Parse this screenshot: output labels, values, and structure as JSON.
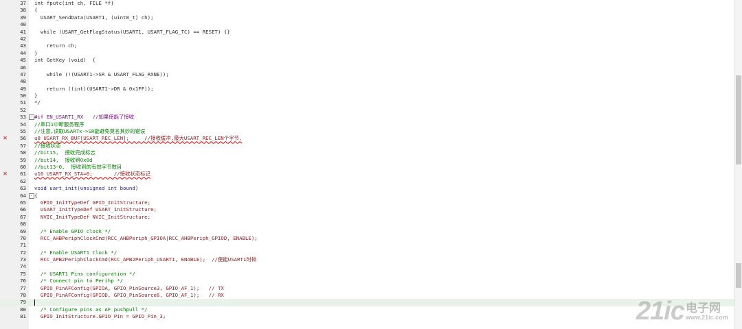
{
  "editor": {
    "lines": [
      {
        "n": "37",
        "text": "int fputc(int ch, FILE *f)",
        "cls": ""
      },
      {
        "n": "38",
        "text": "{",
        "cls": ""
      },
      {
        "n": "39",
        "text": "  USART_SendData(USART1, (uint8_t) ch);",
        "cls": ""
      },
      {
        "n": "40",
        "text": "",
        "cls": ""
      },
      {
        "n": "41",
        "text": "  while (USART_GetFlagStatus(USART1, USART_FLAG_TC) == RESET) {}",
        "cls": ""
      },
      {
        "n": "42",
        "text": "",
        "cls": ""
      },
      {
        "n": "43",
        "text": "    return ch;",
        "cls": ""
      },
      {
        "n": "44",
        "text": "}",
        "cls": ""
      },
      {
        "n": "45",
        "text": "int GetKey (void)  {",
        "cls": ""
      },
      {
        "n": "46",
        "text": "",
        "cls": ""
      },
      {
        "n": "47",
        "text": "    while (!(USART1->SR & USART_FLAG_RXNE));",
        "cls": ""
      },
      {
        "n": "48",
        "text": "",
        "cls": ""
      },
      {
        "n": "49",
        "text": "    return ((int)(USART1->DR & 0x1FF));",
        "cls": ""
      },
      {
        "n": "50",
        "text": "}",
        "cls": ""
      },
      {
        "n": "51",
        "text": "*/",
        "cls": ""
      },
      {
        "n": "52",
        "text": "",
        "cls": ""
      },
      {
        "n": "53",
        "text": "#if EN_USART1_RX   //如果使能了接收",
        "cls": "k-pre",
        "fold": "-"
      },
      {
        "n": "54",
        "text": "//串口1中断服务程序",
        "cls": "k-comment"
      },
      {
        "n": "55",
        "text": "//注意,读取USARTx->SR能避免莫名其妙的错误",
        "cls": "k-comment"
      },
      {
        "n": "56",
        "text": "u8 USART_RX_BUF[USART_REC_LEN];     //接收缓冲,最大USART_REC_LEN个字节.",
        "cls": "k-err",
        "err": "✕"
      },
      {
        "n": "57",
        "text": "//接收状态",
        "cls": "k-comment"
      },
      {
        "n": "58",
        "text": "//bit15,  接收完成标志",
        "cls": "k-comment"
      },
      {
        "n": "59",
        "text": "//bit14,  接收到0x0d",
        "cls": "k-comment"
      },
      {
        "n": "60",
        "text": "//bit13~0,  接收到的有效字节数目",
        "cls": "k-comment"
      },
      {
        "n": "61",
        "text": "u16 USART_RX_STA=0;       //接收状态标记",
        "cls": "k-err",
        "err": "✕"
      },
      {
        "n": "62",
        "text": "",
        "cls": ""
      },
      {
        "n": "63",
        "text": "void uart_init(unsigned int bound)",
        "cls": "k-decl"
      },
      {
        "n": "64",
        "text": "{",
        "cls": "",
        "fold": "-"
      },
      {
        "n": "65",
        "text": "  GPIO_InitTypeDef GPIO_InitStructure;",
        "cls": "k-func"
      },
      {
        "n": "66",
        "text": "  USART_InitTypeDef USART_InitStructure;",
        "cls": "k-func"
      },
      {
        "n": "67",
        "text": "  NVIC_InitTypeDef NVIC_InitStructure;",
        "cls": "k-func"
      },
      {
        "n": "68",
        "text": "",
        "cls": ""
      },
      {
        "n": "69",
        "text": "  /* Enable GPIO clock */",
        "cls": "k-comment"
      },
      {
        "n": "70",
        "text": "  RCC_AHBPeriphClockCmd(RCC_AHBPeriph_GPIOA|RCC_AHBPeriph_GPIOD, ENABLE);",
        "cls": "k-func"
      },
      {
        "n": "71",
        "text": "",
        "cls": ""
      },
      {
        "n": "72",
        "text": "  /* Enable USART1 Clock */",
        "cls": "k-comment"
      },
      {
        "n": "73",
        "text": "  RCC_APB2PeriphClockCmd(RCC_APB2Periph_USART1, ENABLE);  //使能USART1时钟",
        "cls": "k-func"
      },
      {
        "n": "74",
        "text": "",
        "cls": ""
      },
      {
        "n": "75",
        "text": "  /* USART1 Pins configuration */",
        "cls": "k-comment"
      },
      {
        "n": "76",
        "text": "  /* Connect pin to Perihp */",
        "cls": "k-comment"
      },
      {
        "n": "77",
        "text": "  GPIO_PinAFConfig(GPIOA, GPIO_PinSource3, GPIO_AF_1);   // TX",
        "cls": "k-func"
      },
      {
        "n": "78",
        "text": "  GPIO_PinAFConfig(GPIOD, GPIO_PinSource6, GPIO_AF_1);   // RX",
        "cls": "k-func"
      },
      {
        "n": "79",
        "text": "",
        "cls": "",
        "current": true
      },
      {
        "n": "80",
        "text": "  /* Configure pins as AF pushpull */",
        "cls": "k-comment"
      },
      {
        "n": "81",
        "text": "  GPIO_InitStructure.GPIO_Pin = GPIO_Pin_3;",
        "cls": "k-func"
      }
    ]
  },
  "watermark": {
    "logo": "21ic",
    "name": "电子网",
    "url": "www.21ic.com"
  },
  "colors": {
    "comment": "#008000",
    "preprocessor": "#7a0d7a",
    "identifier": "#8b1a1a",
    "error_marker": "#cc1111",
    "current_line": "#e8f2e8"
  }
}
